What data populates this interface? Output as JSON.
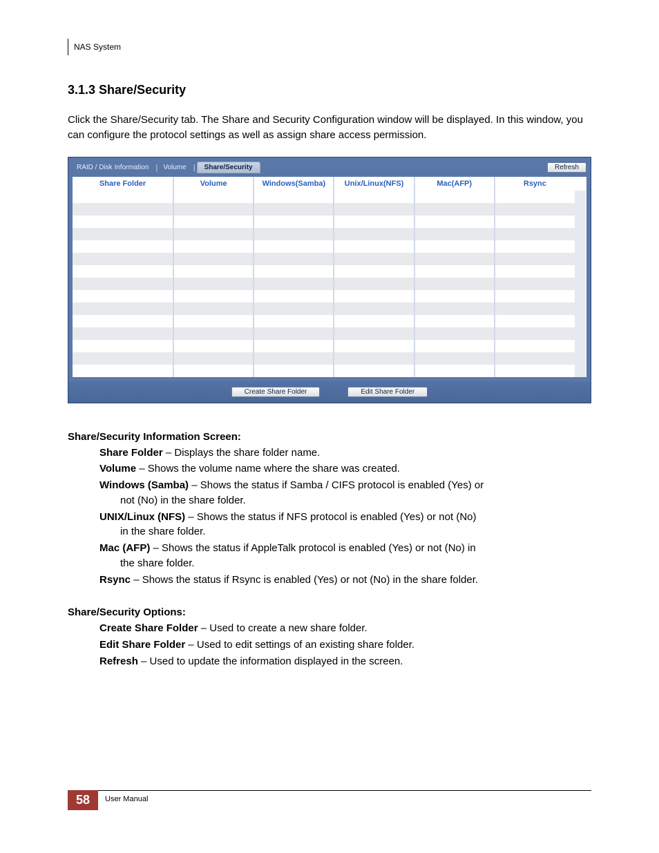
{
  "header": {
    "system_name": "NAS System"
  },
  "section": {
    "number": "3.1.3",
    "title": "Share/Security",
    "heading": "3.1.3  Share/Security",
    "intro": "Click the Share/Security tab. The Share and Security Configuration window will be displayed. In this window, you can configure the protocol settings as well as assign share access permission."
  },
  "screenshot": {
    "tabs": {
      "raid": "RAID / Disk Information",
      "volume": "Volume",
      "share": "Share/Security",
      "separator": "|"
    },
    "buttons": {
      "refresh": "Refresh",
      "create": "Create Share Folder",
      "edit": "Edit Share Folder"
    },
    "columns": {
      "share_folder": "Share Folder",
      "volume": "Volume",
      "windows": "Windows(Samba)",
      "unix": "Unix/Linux(NFS)",
      "mac": "Mac(AFP)",
      "rsync": "Rsync"
    },
    "empty_rows": 15
  },
  "info_screen": {
    "heading": "Share/Security Information Screen:",
    "items": [
      {
        "term": "Share Folder",
        "desc": " – Displays the share folder name."
      },
      {
        "term": "Volume",
        "desc": " – Shows the volume name where the share was created."
      },
      {
        "term": "Windows (Samba)",
        "desc": " – Shows the status if Samba / CIFS protocol is enabled (Yes) or",
        "cont": "not (No) in the share folder."
      },
      {
        "term": "UNIX/Linux (NFS)",
        "desc": " – Shows the status if NFS protocol is enabled (Yes) or not (No)",
        "cont": "in the share folder."
      },
      {
        "term": "Mac (AFP)",
        "desc": " – Shows the status if AppleTalk protocol is enabled (Yes) or not (No) in",
        "cont": "the share folder."
      },
      {
        "term": "Rsync",
        "desc": " – Shows the status if Rsync is enabled (Yes) or not (No) in the share folder."
      }
    ]
  },
  "options": {
    "heading": "Share/Security Options:",
    "items": [
      {
        "term": "Create Share Folder",
        "desc": " – Used to create a new share folder."
      },
      {
        "term": "Edit Share Folder",
        "desc": " – Used to edit settings of an existing share folder."
      },
      {
        "term": "Refresh",
        "desc": " – Used to update the information displayed in the screen."
      }
    ]
  },
  "footer": {
    "page_number": "58",
    "label": "User Manual"
  }
}
